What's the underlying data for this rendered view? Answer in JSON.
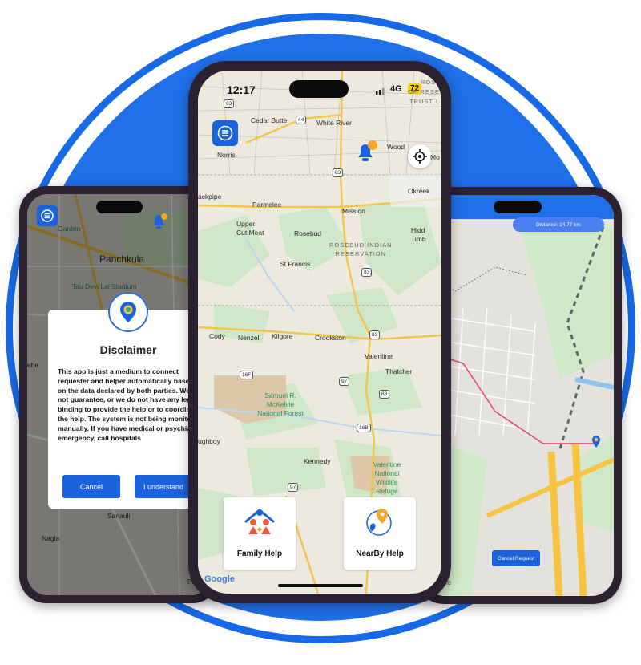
{
  "colors": {
    "brand_blue": "#1f6fe8",
    "button_blue": "#1b63dc",
    "route_pink": "#e0457b"
  },
  "left_phone": {
    "map_labels": {
      "garden": "Garden",
      "city": "Panchkula",
      "stadium": "Tau Devi Lal Stadium",
      "sanauli": "Sanauli",
      "nagla": "Nagla",
      "pand": "Pand",
      "ehe": "ehe"
    },
    "disclaimer": {
      "title": "Disclaimer",
      "body": "This app is just a medium to connect requester and helper automatically based on the data declared by both parties. We do not guarantee, or we do not have any legal binding to provide the help or to coordinate the help. The system is not being monitored manually. If you have medical or psychiatric emergency, call hospitals",
      "cancel_label": "Cancel",
      "confirm_label": "I understand"
    },
    "icons": [
      "menu-icon",
      "bell-icon",
      "map-pin-icon"
    ]
  },
  "center_phone": {
    "status": {
      "time": "12:17",
      "network": "4G",
      "battery": "72"
    },
    "map_labels": {
      "cedar_butte": "Cedar Butte",
      "white_river": "White River",
      "norris": "Norris",
      "wood": "Wood",
      "okreek": "Okreek",
      "ackpipe": "ackpipe",
      "parmelee": "Parmelee",
      "mission": "Mission",
      "upper_cut_meat": "Upper\nCut Meat",
      "rosebud": "Rosebud",
      "rosebud_indian": "ROSEBUD INDIAN\nRESERVATION",
      "st_francis": "St Francis",
      "hidd": "Hidd",
      "timb": "Timb",
      "cody": "Cody",
      "nenzel": "Nenzel",
      "kilgore": "Kilgore",
      "crookston": "Crookston",
      "valentine": "Valentine",
      "thatcher": "Thatcher",
      "samuel": "Samuel R.\nMcKelvie\nNational Forest",
      "ughboy": "ughboy",
      "kennedy": "Kennedy",
      "valentine_refuge": "Valentine\nNational\nWildlife\nRefuge",
      "rose": "ROSE",
      "f_reser": "OF RESER",
      "trust": "TRUST L",
      "mo": "Mo"
    },
    "shields": [
      "63",
      "44",
      "83",
      "83",
      "83",
      "16F",
      "97",
      "83",
      "16B",
      "97"
    ],
    "cards": [
      {
        "label": "Family Help",
        "icon": "family-icon"
      },
      {
        "label": "NearBy Help",
        "icon": "nearby-icon"
      }
    ],
    "google": "Google"
  },
  "right_phone": {
    "distance": "Distance: 14.77 km",
    "cancel_request": "Cancel Request",
    "google": "Google"
  }
}
